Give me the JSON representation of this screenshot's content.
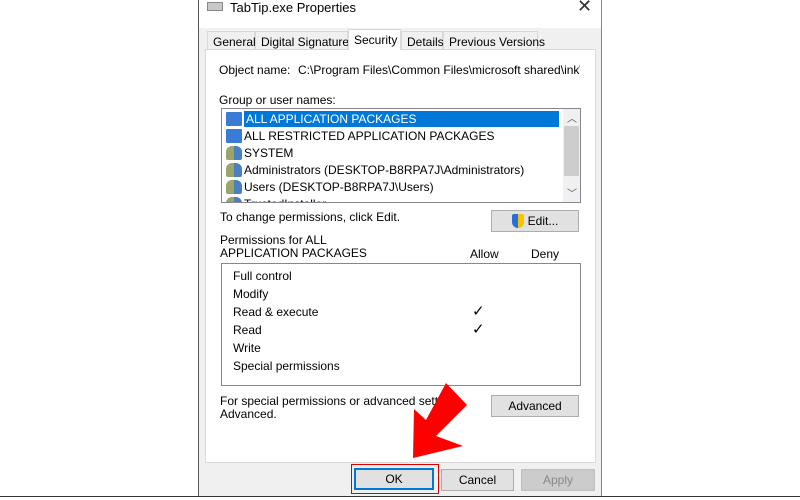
{
  "window": {
    "title": "TabTip.exe Properties",
    "close_icon": "close-icon",
    "app_icon": "keyboard-icon"
  },
  "tabs": [
    {
      "label": "General"
    },
    {
      "label": "Digital Signatures"
    },
    {
      "label": "Security",
      "active": true
    },
    {
      "label": "Details"
    },
    {
      "label": "Previous Versions"
    }
  ],
  "security": {
    "object_name_label": "Object name:",
    "object_name_value": "C:\\Program Files\\Common Files\\microsoft shared\\ink\\TabTi",
    "group_label": "Group or user names:",
    "groups": [
      {
        "name": "ALL APPLICATION PACKAGES",
        "icon": "app-packages-icon",
        "selected": true
      },
      {
        "name": "ALL RESTRICTED APPLICATION PACKAGES",
        "icon": "app-packages-icon"
      },
      {
        "name": "SYSTEM",
        "icon": "users-icon"
      },
      {
        "name": "Administrators (DESKTOP-B8RPA7J\\Administrators)",
        "icon": "users-icon"
      },
      {
        "name": "Users (DESKTOP-B8RPA7J\\Users)",
        "icon": "users-icon"
      },
      {
        "name": "TrustedInstaller",
        "icon": "users-icon"
      }
    ],
    "change_text": "To change permissions, click Edit.",
    "edit_label": "Edit...",
    "perm_label": "Permissions for ALL APPLICATION PACKAGES",
    "allow_label": "Allow",
    "deny_label": "Deny",
    "permissions": [
      {
        "name": "Full control",
        "allow": false,
        "deny": false
      },
      {
        "name": "Modify",
        "allow": false,
        "deny": false
      },
      {
        "name": "Read & execute",
        "allow": true,
        "deny": false
      },
      {
        "name": "Read",
        "allow": true,
        "deny": false
      },
      {
        "name": "Write",
        "allow": false,
        "deny": false
      },
      {
        "name": "Special permissions",
        "allow": false,
        "deny": false
      }
    ],
    "check_glyph": "✓",
    "advanced_text": "For special permissions or advanced settings, click Advanced.",
    "advanced_text_line1": "For special permissions or advanced settings,",
    "advanced_text_line2": "Advanced.",
    "advanced_label": "Advanced"
  },
  "footer": {
    "ok": "OK",
    "cancel": "Cancel",
    "apply": "Apply"
  },
  "colors": {
    "selection": "#0078d7",
    "highlight_box": "#e00000",
    "arrow": "#ff0000"
  }
}
